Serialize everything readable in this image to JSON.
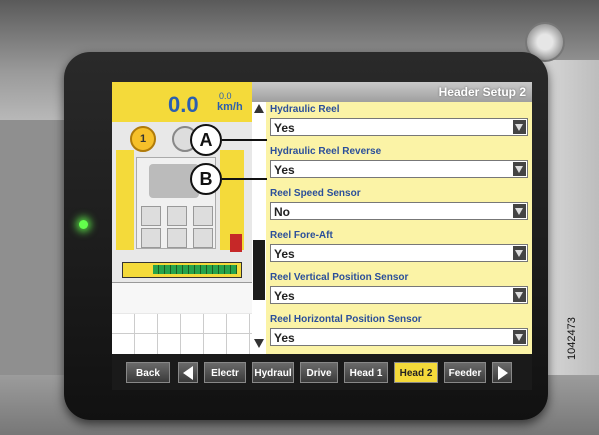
{
  "screen": {
    "title": "Header Setup 2",
    "speed": {
      "value": "0.0",
      "small_value": "0.0",
      "unit": "km/h"
    },
    "gear_number": "1",
    "settings": [
      {
        "label": "Hydraulic Reel",
        "value": "Yes"
      },
      {
        "label": "Hydraulic Reel Reverse",
        "value": "Yes"
      },
      {
        "label": "Reel Speed Sensor",
        "value": "No"
      },
      {
        "label": "Reel Fore-Aft",
        "value": "Yes"
      },
      {
        "label": "Reel Vertical Position Sensor",
        "value": "Yes"
      },
      {
        "label": "Reel Horizontal Position Sensor",
        "value": "Yes"
      }
    ],
    "nav": {
      "back": "Back",
      "tabs": [
        "Electr",
        "Hydraul",
        "Drive",
        "Head 1",
        "Head 2",
        "Feeder"
      ],
      "active_tab": "Head 2"
    }
  },
  "callouts": {
    "a": "A",
    "b": "B"
  },
  "figure_id": "1042473",
  "colors": {
    "accent_yellow": "#f4da3a",
    "label_blue": "#2b4f9a",
    "led_green": "#63ff4c"
  }
}
